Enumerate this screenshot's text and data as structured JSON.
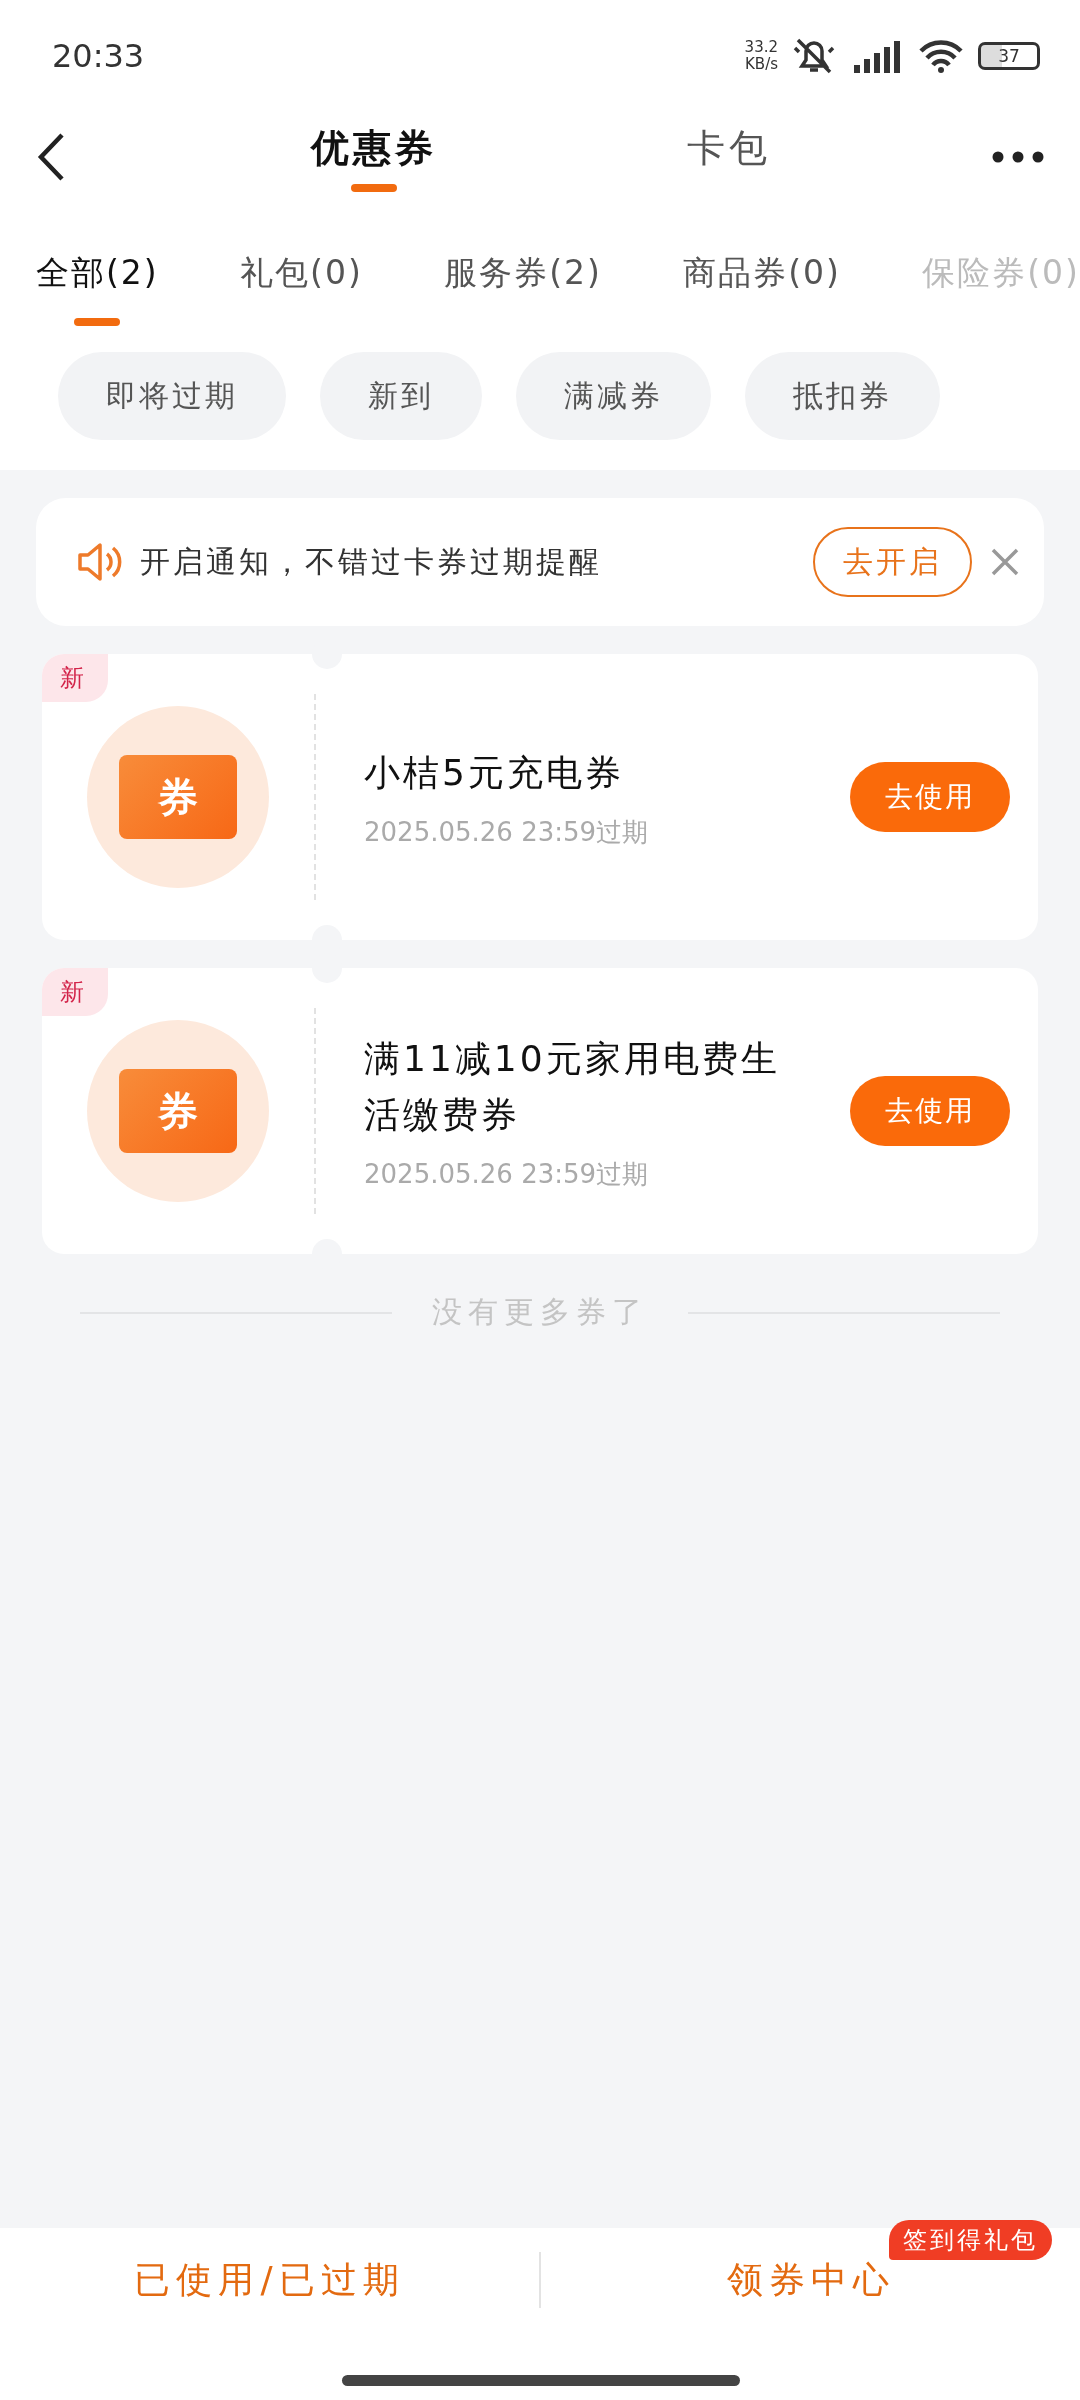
{
  "status_bar": {
    "time": "20:33",
    "net_speed": "33.2",
    "net_unit": "KB/s",
    "battery": "37"
  },
  "header": {
    "tabs": [
      {
        "label": "优惠券",
        "selected": true
      },
      {
        "label": "卡包",
        "selected": false
      }
    ]
  },
  "categories": [
    {
      "label": "全部(2)",
      "selected": true
    },
    {
      "label": "礼包(0)",
      "selected": false
    },
    {
      "label": "服务券(2)",
      "selected": false
    },
    {
      "label": "商品券(0)",
      "selected": false
    },
    {
      "label": "保险券(0)",
      "selected": false
    }
  ],
  "filters": [
    "即将过期",
    "新到",
    "满减券",
    "抵扣券"
  ],
  "notice": {
    "text": "开启通知，不错过卡券过期提醒",
    "button": "去开启"
  },
  "coupons": [
    {
      "badge": "新",
      "icon_label": "券",
      "title": "小桔5元充电券",
      "expiry": "2025.05.26 23:59过期",
      "button": "去使用"
    },
    {
      "badge": "新",
      "icon_label": "券",
      "title": "满11减10元家用电费生活缴费券",
      "expiry": "2025.05.26 23:59过期",
      "button": "去使用"
    }
  ],
  "end_text": "没有更多券了",
  "bottom_bar": {
    "left": "已使用/已过期",
    "right": "领券中心",
    "right_badge": "签到得礼包"
  }
}
